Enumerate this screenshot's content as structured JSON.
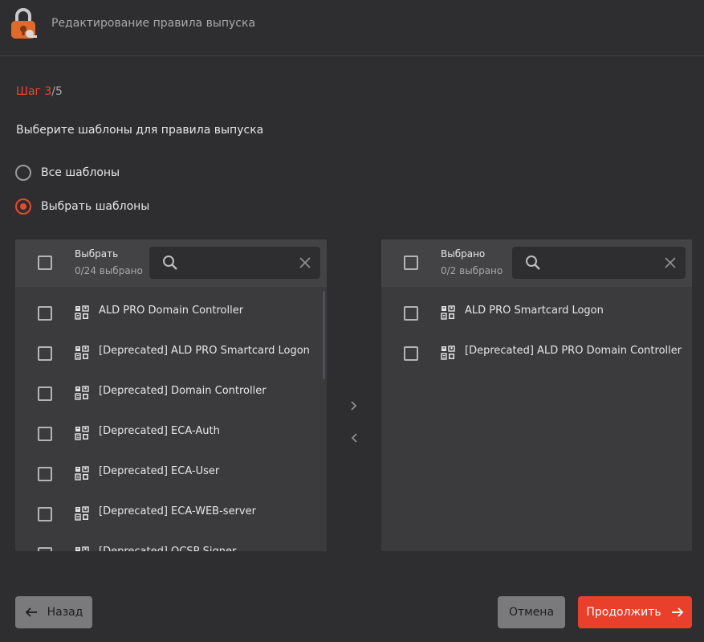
{
  "header": {
    "title": "Редактирование правила выпуска",
    "logo_icon": "lock-key-logo-icon"
  },
  "step": {
    "current": "Шаг 3",
    "separator": "/",
    "total": "5"
  },
  "question": "Выберите шаблоны для правила выпуска",
  "radio": {
    "all_label": "Все шаблоны",
    "choose_label": "Выбрать шаблоны",
    "selected": "choose"
  },
  "left_panel": {
    "title": "Выбрать",
    "count": "0/24 выбрано",
    "search_placeholder": "",
    "items": [
      "ALD PRO Domain Controller",
      "[Deprecated] ALD PRO Smartcard Logon",
      "[Deprecated] Domain Controller",
      "[Deprecated] ECA-Auth",
      "[Deprecated] ECA-User",
      "[Deprecated] ECA-WEB-server",
      "[Deprecated] OCSP Signer"
    ]
  },
  "right_panel": {
    "title": "Выбрано",
    "count": "0/2 выбрано",
    "search_placeholder": "",
    "items": [
      "ALD PRO Smartcard Logon",
      "[Deprecated] ALD PRO Domain Controller"
    ]
  },
  "footer": {
    "back": "Назад",
    "cancel": "Отмена",
    "next": "Продолжить"
  },
  "colors": {
    "accent": "#e8402a",
    "background": "#2e2e31",
    "panel": "#3b3b3e"
  }
}
